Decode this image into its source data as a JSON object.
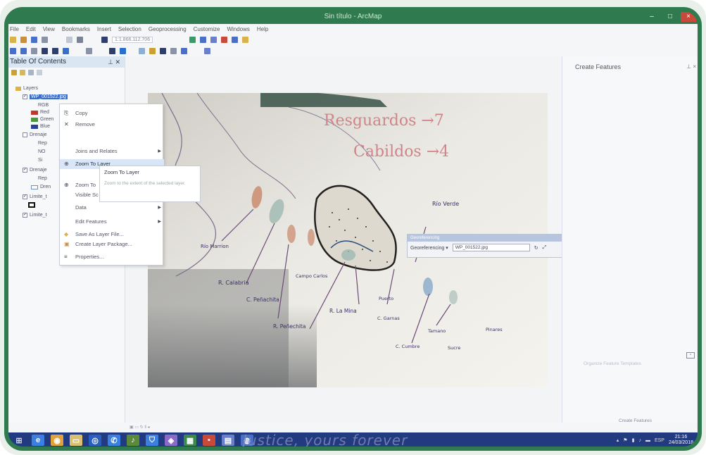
{
  "window": {
    "title": "Sin título - ArcMap",
    "minimize": "–",
    "maximize": "□",
    "close": "×"
  },
  "menu": [
    "File",
    "Edit",
    "View",
    "Bookmarks",
    "Insert",
    "Selection",
    "Geoprocessing",
    "Customize",
    "Windows",
    "Help"
  ],
  "toolbar": {
    "scale": "1:1.866.112.706"
  },
  "toc": {
    "title": "Table Of Contents",
    "layers_label": "Layers",
    "selected_layer": "WP_001522.jpg",
    "rgb": "RGB",
    "bands": [
      {
        "label": "Red",
        "color": "#c0392b"
      },
      {
        "label": "Green",
        "color": "#4a9a3a"
      },
      {
        "label": "Blue",
        "color": "#2c3e9c"
      }
    ],
    "rows": [
      "Drenaje",
      "Rep",
      "NO",
      "Si",
      "Drenaje",
      "Rep",
      "Dren",
      "Limite_t",
      "Limite_t"
    ]
  },
  "context_menu": {
    "items": [
      {
        "label": "Copy",
        "icon": "⎘"
      },
      {
        "label": "Remove",
        "icon": "✕"
      },
      {
        "label": "Joins and Relates",
        "icon": ""
      },
      {
        "label": "Zoom To Layer",
        "icon": "🔍"
      },
      {
        "label": "Zoom To",
        "icon": "🔍"
      },
      {
        "label": "Visible Sc",
        "icon": ""
      },
      {
        "label": "Data",
        "icon": ""
      },
      {
        "label": "Edit Features",
        "icon": ""
      },
      {
        "label": "Save As Layer File...",
        "icon": "◆"
      },
      {
        "label": "Create Layer Package...",
        "icon": "▣"
      },
      {
        "label": "Properties...",
        "icon": "≡"
      }
    ]
  },
  "tooltip": {
    "title": "Zoom To Layer",
    "desc": "Zoom to the extent of the selected layer."
  },
  "map": {
    "handwriting": {
      "line1": "Resguardos →7",
      "line2": "Cabildos →4",
      "labels": [
        "Río Marrion",
        "R. Calabria",
        "C. Peñachita",
        "Campo Carlos",
        "R. La Mina",
        "R. Peñechita",
        "Puerto",
        "C. Garnas",
        "C. Cumbre",
        "Tamano",
        "Pinares",
        "Sucre",
        "Río Verde"
      ]
    }
  },
  "georef": {
    "title": "Georeferencing",
    "menu": "Georeferencing ▾",
    "layer": "WP_001522.jpg"
  },
  "create_features": {
    "title": "Create Features",
    "faint": "Organize Feature Templates",
    "footer": "Create Features"
  },
  "taskbar": {
    "overlay_text": "Justice, yours forever",
    "lang": "ESP",
    "time": "21:16",
    "date": "24/03/2018"
  }
}
